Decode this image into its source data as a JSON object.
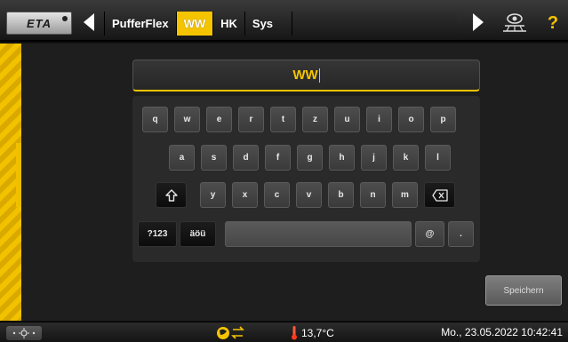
{
  "header": {
    "logo_text": "ETA",
    "tabs": [
      {
        "label": "PufferFlex",
        "active": false
      },
      {
        "label": "WW",
        "active": true
      },
      {
        "label": "HK",
        "active": false
      },
      {
        "label": "Sys",
        "active": false
      }
    ],
    "help_label": "?"
  },
  "editor": {
    "value": "WW"
  },
  "keyboard": {
    "row1": [
      "q",
      "w",
      "e",
      "r",
      "t",
      "z",
      "u",
      "i",
      "o",
      "p"
    ],
    "row2": [
      "a",
      "s",
      "d",
      "f",
      "g",
      "h",
      "j",
      "k",
      "l"
    ],
    "row3": [
      "y",
      "x",
      "c",
      "v",
      "b",
      "n",
      "m"
    ],
    "shift_icon": "shift-arrow-icon",
    "backspace_icon": "backspace-icon",
    "numbers_label": "?123",
    "umlaut_label": "äöü",
    "at_label": "@",
    "dot_label": "."
  },
  "save_button_label": "Speichern",
  "statusbar": {
    "temperature": "13,7°C",
    "datetime": "Mo., 23.05.2022 10:42:41"
  },
  "colors": {
    "accent": "#f5c400",
    "background": "#1e1e1e",
    "key": "#444444",
    "key_dark": "#121212"
  }
}
